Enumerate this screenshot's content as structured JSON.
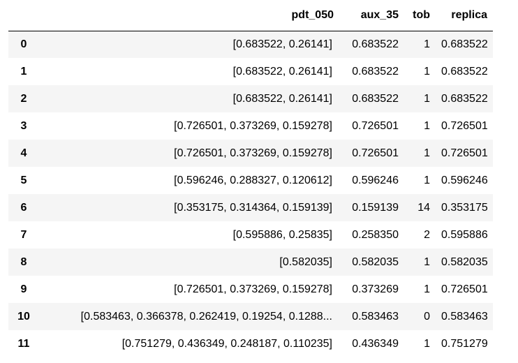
{
  "table": {
    "columns": {
      "index": "",
      "pdt_050": "pdt_050",
      "aux_35": "aux_35",
      "tob": "tob",
      "replica": "replica"
    },
    "rows": [
      {
        "index": "0",
        "pdt_050": "[0.683522, 0.26141]",
        "aux_35": "0.683522",
        "tob": "1",
        "replica": "0.683522"
      },
      {
        "index": "1",
        "pdt_050": "[0.683522, 0.26141]",
        "aux_35": "0.683522",
        "tob": "1",
        "replica": "0.683522"
      },
      {
        "index": "2",
        "pdt_050": "[0.683522, 0.26141]",
        "aux_35": "0.683522",
        "tob": "1",
        "replica": "0.683522"
      },
      {
        "index": "3",
        "pdt_050": "[0.726501, 0.373269, 0.159278]",
        "aux_35": "0.726501",
        "tob": "1",
        "replica": "0.726501"
      },
      {
        "index": "4",
        "pdt_050": "[0.726501, 0.373269, 0.159278]",
        "aux_35": "0.726501",
        "tob": "1",
        "replica": "0.726501"
      },
      {
        "index": "5",
        "pdt_050": "[0.596246, 0.288327, 0.120612]",
        "aux_35": "0.596246",
        "tob": "1",
        "replica": "0.596246"
      },
      {
        "index": "6",
        "pdt_050": "[0.353175, 0.314364, 0.159139]",
        "aux_35": "0.159139",
        "tob": "14",
        "replica": "0.353175"
      },
      {
        "index": "7",
        "pdt_050": "[0.595886, 0.25835]",
        "aux_35": "0.258350",
        "tob": "2",
        "replica": "0.595886"
      },
      {
        "index": "8",
        "pdt_050": "[0.582035]",
        "aux_35": "0.582035",
        "tob": "1",
        "replica": "0.582035"
      },
      {
        "index": "9",
        "pdt_050": "[0.726501, 0.373269, 0.159278]",
        "aux_35": "0.373269",
        "tob": "1",
        "replica": "0.726501"
      },
      {
        "index": "10",
        "pdt_050": "[0.583463, 0.366378, 0.262419, 0.19254, 0.1288...",
        "aux_35": "0.583463",
        "tob": "0",
        "replica": "0.583463"
      },
      {
        "index": "11",
        "pdt_050": "[0.751279, 0.436349, 0.248187, 0.110235]",
        "aux_35": "0.436349",
        "tob": "1",
        "replica": "0.751279"
      }
    ]
  }
}
